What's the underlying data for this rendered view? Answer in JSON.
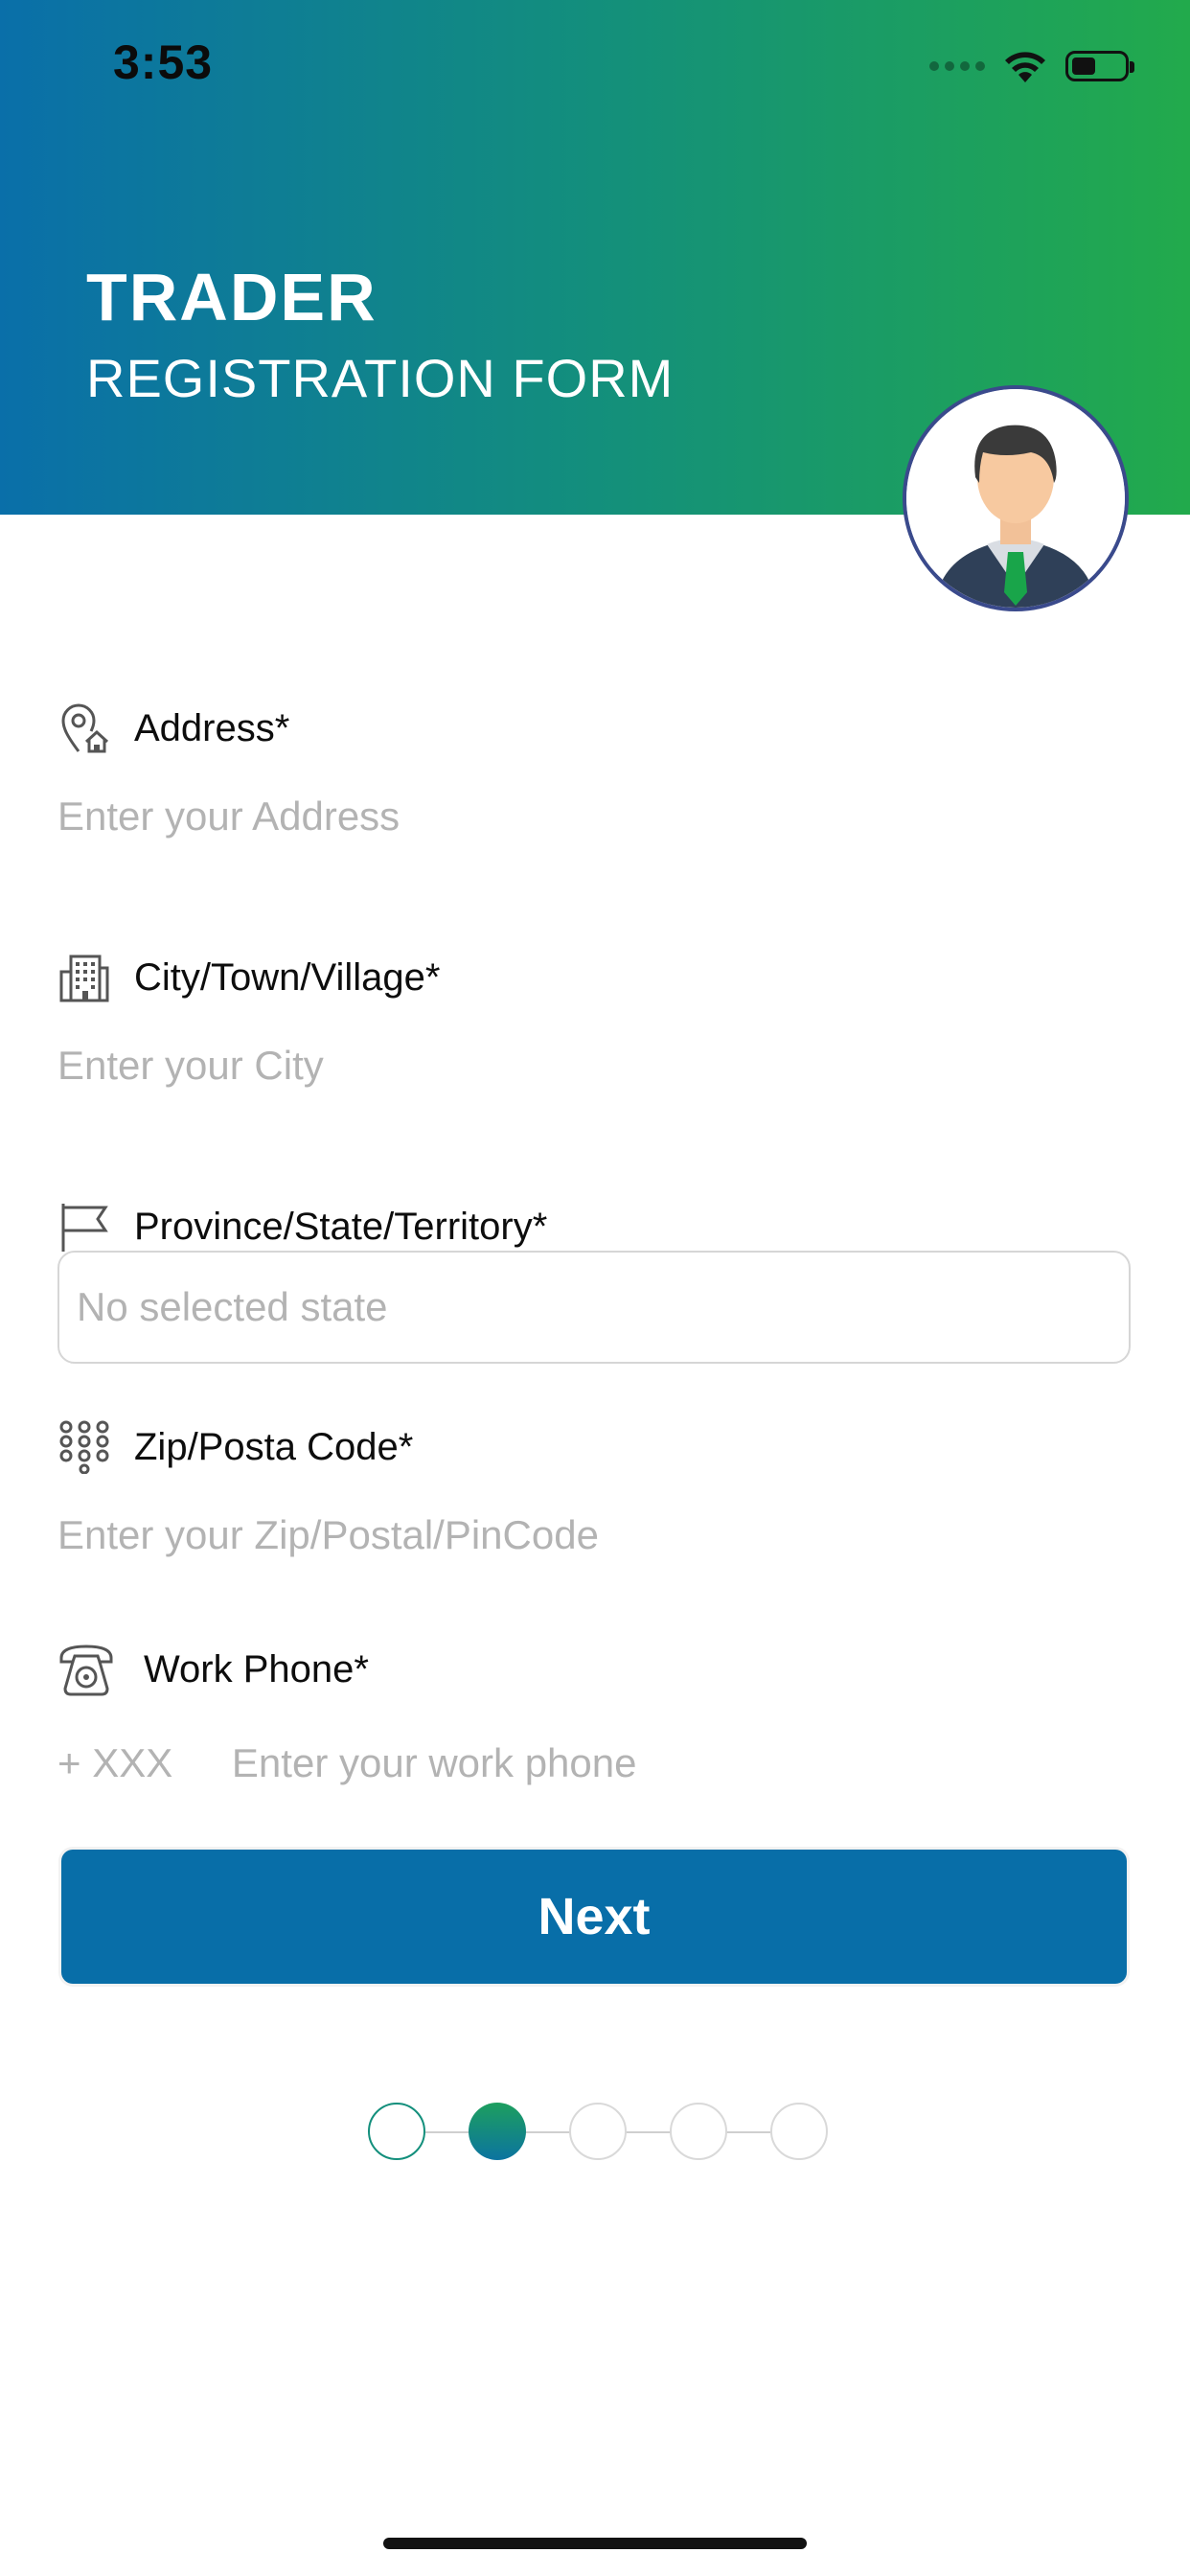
{
  "status_bar": {
    "time": "3:53",
    "icons": [
      "signal-icon",
      "wifi-icon",
      "battery-icon"
    ]
  },
  "header": {
    "title": "TRADER",
    "subtitle": "REGISTRATION FORM",
    "gradient": [
      "#0a6fa9",
      "#22aa4c"
    ]
  },
  "avatar": {
    "icon": "businessman-avatar-icon"
  },
  "form": {
    "address": {
      "icon": "location-home-icon",
      "label": "Address*",
      "placeholder": "Enter your Address"
    },
    "city": {
      "icon": "building-icon",
      "label": "City/Town/Village*",
      "placeholder": "Enter your City"
    },
    "province": {
      "icon": "flag-icon",
      "label": "Province/State/Territory*",
      "selected": "No selected state"
    },
    "zip": {
      "icon": "keypad-icon",
      "label": "Zip/Posta Code*",
      "placeholder": "Enter your Zip/Postal/PinCode"
    },
    "work_phone": {
      "icon": "telephone-icon",
      "label": "Work Phone*",
      "prefix": "+ XXX",
      "placeholder": "Enter your work phone"
    }
  },
  "next_button": {
    "label": "Next",
    "color": "#086ea8"
  },
  "stepper": {
    "total_steps": 5,
    "current_step": 2
  }
}
